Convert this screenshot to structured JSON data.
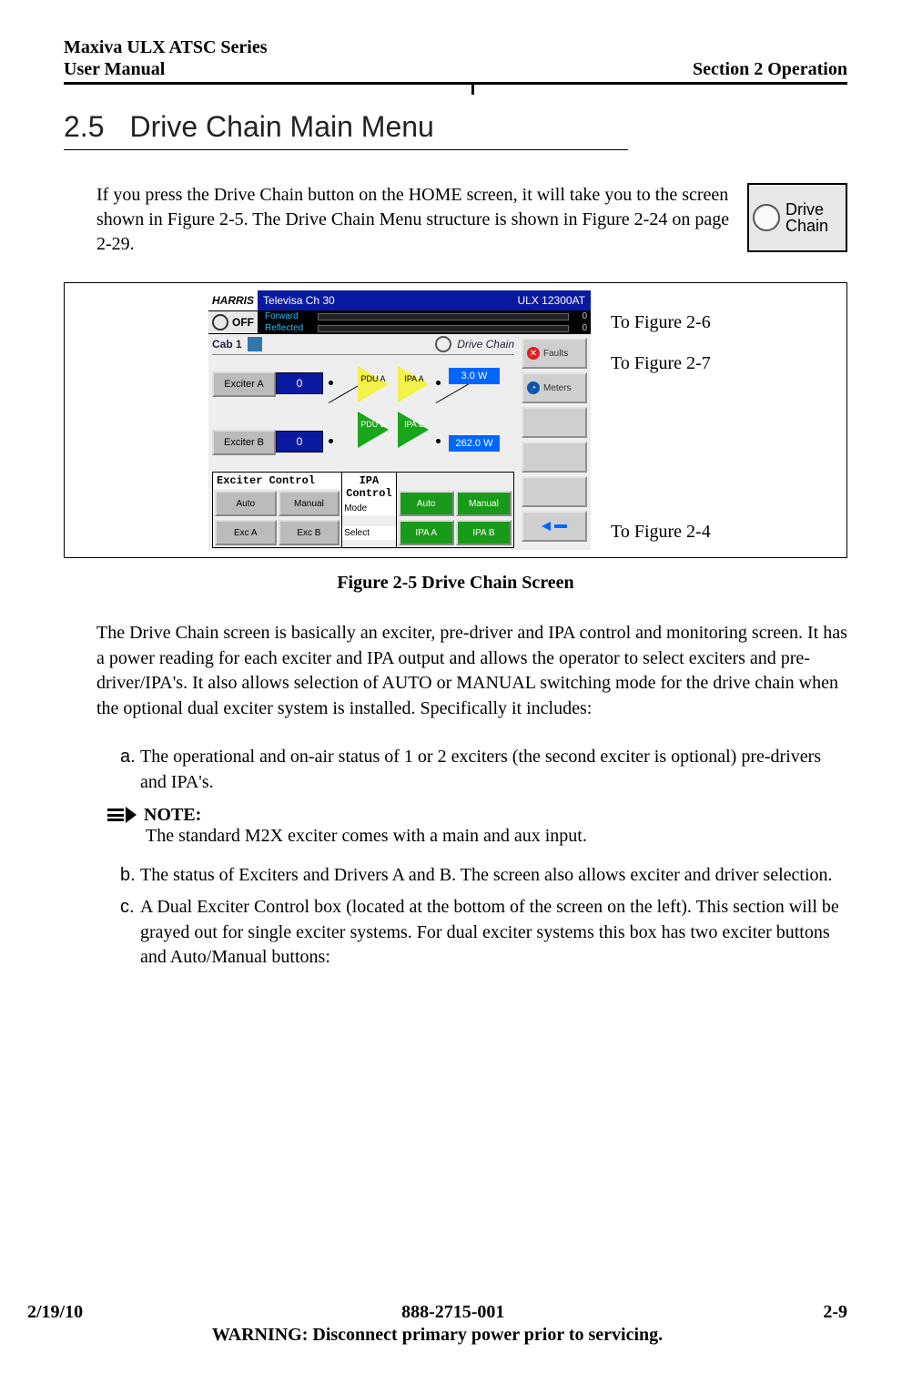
{
  "header": {
    "left_line1": "Maxiva ULX ATSC Series",
    "left_line2": "User Manual",
    "right": "Section 2 Operation"
  },
  "section": {
    "num": "2.5",
    "title": "Drive Chain Main Menu"
  },
  "intro_para": "If you press the Drive Chain button on the HOME screen, it will take you to the screen shown in Figure 2-5. The Drive Chain Menu structure is shown in Figure 2-24 on page 2-29.",
  "drive_chip": {
    "line1": "Drive",
    "line2": "Chain"
  },
  "screen": {
    "logo": "HARRIS",
    "title_center": "Televisa Ch 30",
    "title_right": "ULX 12300AT",
    "off_label": "OFF",
    "fwd_label": "Forward",
    "ref_label": "Reflected",
    "fwd_val": "0",
    "ref_val": "0",
    "crumb_cab": "Cab 1",
    "crumb_title": "Drive Chain",
    "exciter_a": "Exciter A",
    "exciter_b": "Exciter B",
    "ex_a_val": "0",
    "ex_b_val": "0",
    "pdu_a": "PDU\nA",
    "ipa_a": "IPA\nA",
    "pdu_b": "PDU\nB",
    "ipa_b": "IPA\nB",
    "pwr_top": "3.0 W",
    "pwr_bot": "262.0 W",
    "exc_ctrl": "Exciter Control",
    "ipa_ctrl": "IPA Control",
    "mode_lbl": "Mode",
    "select_lbl": "Select",
    "btn_auto": "Auto",
    "btn_manual": "Manual",
    "btn_exca": "Exc A",
    "btn_excb": "Exc B",
    "btn_ipa_auto": "Auto",
    "btn_ipa_manual": "Manual",
    "btn_ipa_a": "IPA A",
    "btn_ipa_b": "IPA B",
    "side_faults": "Faults",
    "side_meters": "Meters"
  },
  "annotations": {
    "to_fig_2_6": "To Figure 2-6",
    "to_fig_2_7": "To Figure 2-7",
    "to_fig_2_4": "To Figure 2-4"
  },
  "figure_caption": "Figure 2-5  Drive Chain Screen",
  "body_para": "The Drive Chain screen is basically an exciter, pre-driver and IPA control and monitoring screen. It has a power reading for each exciter and IPA output and allows the operator to select exciters and pre-driver/IPA's. It also allows selection of AUTO or MANUAL switching mode for the drive chain when the optional dual exciter system is installed. Specifically it includes:",
  "items": {
    "a": "The operational and on-air status of 1 or 2 exciters (the second exciter is optional) pre-drivers and IPA's.",
    "b": "The status of Exciters and Drivers A and B. The screen also allows exciter and driver selection.",
    "c": "A Dual Exciter Control box (located at the bottom of the screen on the left). This section will be grayed out for single exciter systems. For dual exciter systems this box has two exciter buttons and Auto/Manual buttons:"
  },
  "markers": {
    "a": "a.",
    "b": "b.",
    "c": "c."
  },
  "note": {
    "heading": "NOTE:",
    "body": "The standard M2X exciter comes with a main and aux input."
  },
  "footer": {
    "left": "2/19/10",
    "center": "888-2715-001",
    "right": "2-9",
    "warning": "WARNING: Disconnect primary power prior to servicing."
  }
}
